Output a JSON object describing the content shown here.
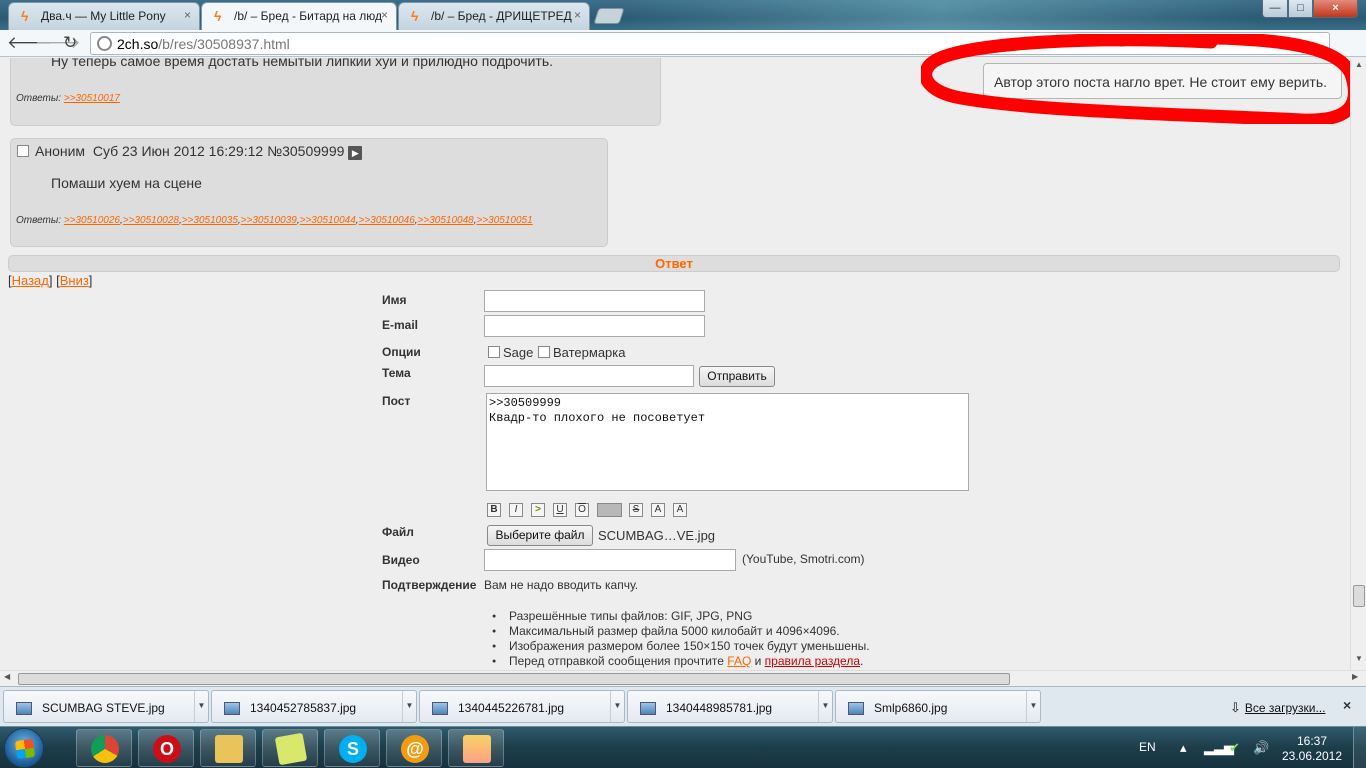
{
  "browser": {
    "tabs": [
      {
        "title": "Два.ч — My Little Pony",
        "active": false
      },
      {
        "title": "/b/ – Бред - Битард на люд",
        "active": true
      },
      {
        "title": "/b/ – Бред - ДРИЩЕТРЕД",
        "active": false
      }
    ],
    "close_glyph": "×",
    "url_host": "2ch.so",
    "url_path": "/b/res/30508937.html",
    "window_buttons": {
      "minimize": "—",
      "maximize": "□",
      "close": "×"
    }
  },
  "posts": [
    {
      "body": "Ну теперь самое время достать немытый липкий хуй и прилюдно подрочить.",
      "replies_label": "Ответы:",
      "replies": [
        ">>30510017"
      ]
    },
    {
      "author": "Аноним",
      "date": "Суб 23 Июн 2012 16:29:12",
      "number": "№30509999",
      "body": "Помаши хуем на сцене",
      "replies_label": "Ответы:",
      "replies": [
        ">>30510026",
        ">>30510028",
        ">>30510035",
        ">>30510039",
        ">>30510044",
        ">>30510046",
        ">>30510048",
        ">>30510051"
      ]
    }
  ],
  "tooltip": "Автор этого поста нагло врет. Не стоит ему верить.",
  "reply_form": {
    "header": "Ответ",
    "nav_back": "Назад",
    "nav_down": "Вниз",
    "labels": {
      "name": "Имя",
      "email": "E-mail",
      "options": "Опции",
      "subject": "Тема",
      "post": "Пост",
      "file": "Файл",
      "video": "Видео",
      "confirm": "Подтверждение"
    },
    "option_sage": "Sage",
    "option_watermark": "Ватермарка",
    "submit": "Отправить",
    "post_text": ">>30509999\nКвадр-то плохого не посоветует",
    "format_buttons": [
      "B",
      "I",
      ">",
      "U",
      "O",
      "",
      "S",
      "A",
      "A"
    ],
    "file_button": "Выберите файл",
    "file_name": "SCUMBAG…VE.jpg",
    "video_hint": "(YouTube, Smotri.com)",
    "captcha_note": "Вам не надо вводить капчу.",
    "rules": [
      "Разрешённые типы файлов: GIF, JPG, PNG",
      "Максимальный размер файла 5000 килобайт и 4096×4096.",
      "Изображения размером более 150×150 точек будут уменьшены."
    ],
    "rule_last_prefix": "Перед отправкой сообщения прочтите ",
    "rule_last_faq": "FAQ",
    "rule_last_mid": " и ",
    "rule_last_rules": "правила раздела",
    "rule_last_suffix": "."
  },
  "downloads": {
    "items": [
      "SCUMBAG STEVE.jpg",
      "1340452785837.jpg",
      "1340445226781.jpg",
      "1340448985781.jpg",
      "Smlp6860.jpg"
    ],
    "show_all": "Все загрузки...",
    "close": "×"
  },
  "taskbar": {
    "language": "EN",
    "time": "16:37",
    "date": "23.06.2012"
  },
  "colors": {
    "link": "#ff6600",
    "annotation": "#ff0000"
  }
}
